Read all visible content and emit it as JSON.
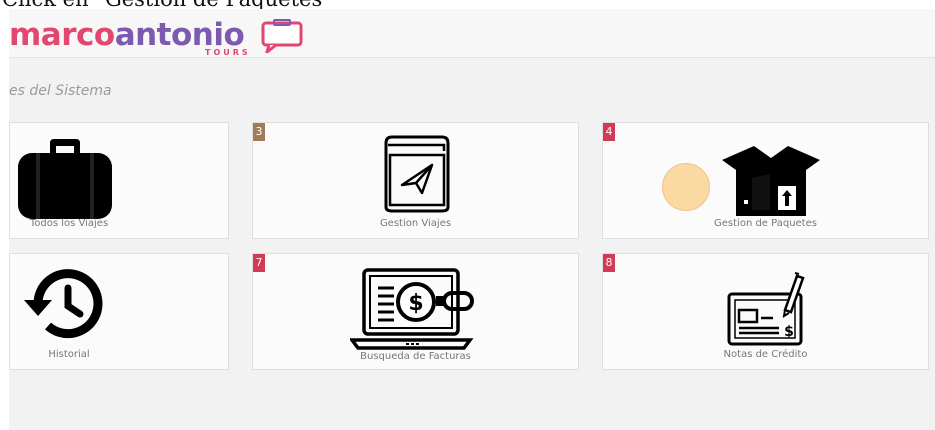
{
  "caption": "Click en \"Gestion de Paquetes\"",
  "brand": {
    "name_part1": "marco",
    "name_part2": "antonio",
    "sub": "TOURS",
    "pink": "#e2486f",
    "purple": "#7b5ab0"
  },
  "section": {
    "title": "es del Sistema"
  },
  "tiles": [
    {
      "label": "Todos los Viajes",
      "badge": "",
      "icon": "suitcase-icon"
    },
    {
      "label": "Gestion Viajes",
      "badge": "3",
      "badge_color": "#a07b55",
      "icon": "paper-plane-icon"
    },
    {
      "label": "Gestion de Paquetes",
      "badge": "4",
      "badge_color": "#d33a55",
      "icon": "box-icon"
    },
    {
      "label": "Historial",
      "badge": "",
      "icon": "history-icon"
    },
    {
      "label": "Busqueda de Facturas",
      "badge": "7",
      "badge_color": "#d33a55",
      "icon": "invoice-search-icon"
    },
    {
      "label": "Notas de Crédito",
      "badge": "8",
      "badge_color": "#d33a55",
      "icon": "check-pen-icon"
    }
  ]
}
